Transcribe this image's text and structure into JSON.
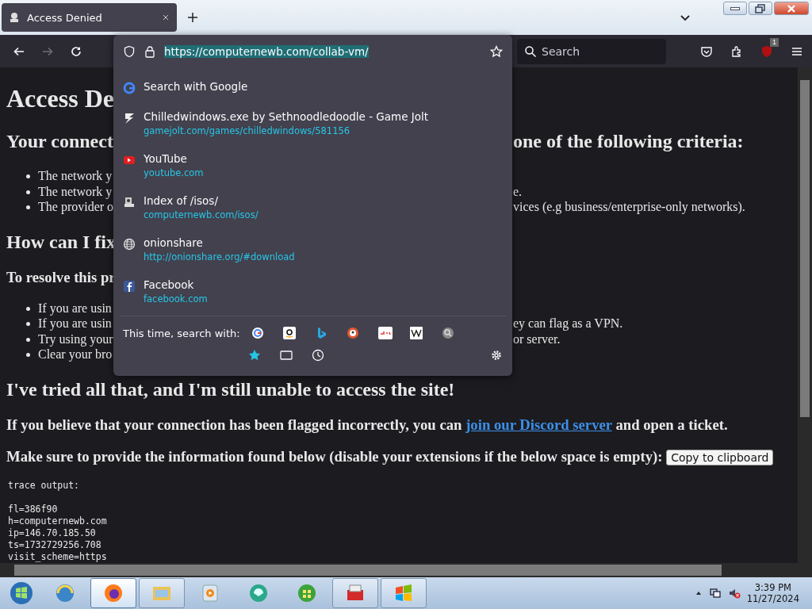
{
  "tabs": [
    {
      "title": "Access Denied",
      "selected": true
    }
  ],
  "nav_buttons": [
    {
      "kind": "back",
      "disabled": false
    },
    {
      "kind": "forward",
      "disabled": true
    },
    {
      "kind": "reload",
      "disabled": false
    }
  ],
  "address_bar": {
    "value": "https://computernewb.com/collab-vm/",
    "text_selected": true
  },
  "search": {
    "placeholder": "Search"
  },
  "extension_badge": "1",
  "suggestions": [
    {
      "title": "Search with Google"
    },
    {
      "title": "Chilledwindows.exe by Sethnoodledoodle - Game Jolt",
      "url": "gamejolt.com/games/chilledwindows/581156"
    },
    {
      "title": "YouTube",
      "url": "youtube.com"
    },
    {
      "title": "Index of /isos/",
      "url": "computernewb.com/isos/"
    },
    {
      "title": "onionshare",
      "url": "http://onionshare.org/#download"
    },
    {
      "title": "Facebook",
      "url": "facebook.com"
    }
  ],
  "search_with_label": "This time, search with:",
  "page": {
    "blocks": [
      {
        "kind": "h1",
        "left": "Access De"
      },
      {
        "kind": "h2",
        "left": "Your connect",
        "right": "one of the following criteria:"
      },
      {
        "kind": "list",
        "items": [
          {
            "left": "The network y"
          },
          {
            "left": "The network y",
            "right": "e."
          },
          {
            "left": "The provider o",
            "right": "vices (e.g business/enterprise-only networks)."
          }
        ]
      },
      {
        "kind": "h2",
        "left": "How can I fix"
      },
      {
        "kind": "h3",
        "left": "To resolve this pr"
      },
      {
        "kind": "list",
        "items": [
          {
            "left": "If you are usin"
          },
          {
            "left": "If you are usin",
            "right": "ey can flag as a VPN."
          },
          {
            "left": "Try using your",
            "right": "or server."
          },
          {
            "left": "Clear your bro"
          }
        ]
      },
      {
        "kind": "h2",
        "text": "I've tried all that, and I'm still unable to access the site!"
      },
      {
        "kind": "p",
        "text": "If you believe that your connection has been flagged incorrectly, you can",
        "link": "join our Discord server",
        "after": "and open a ticket."
      },
      {
        "kind": "p",
        "text": "Make sure to provide the information found below (disable your extensions if the below space is empty):",
        "button": "Copy to clipboard"
      },
      {
        "kind": "pre",
        "heading": "trace output:",
        "lines": [
          "fl=386f90",
          "h=computernewb.com",
          "ip=146.70.185.50",
          "ts=1732729256.708",
          "visit_scheme=https"
        ]
      }
    ]
  },
  "taskbar": {
    "apps": [
      {
        "running": false,
        "active": false
      },
      {
        "running": true,
        "active": true
      },
      {
        "running": true,
        "active": false
      },
      {
        "running": false,
        "active": false
      },
      {
        "running": false,
        "active": false
      },
      {
        "running": false,
        "active": false
      },
      {
        "running": true,
        "active": false
      },
      {
        "running": true,
        "active": false
      }
    ],
    "time": "3:39 PM",
    "date": "11/27/2024"
  }
}
